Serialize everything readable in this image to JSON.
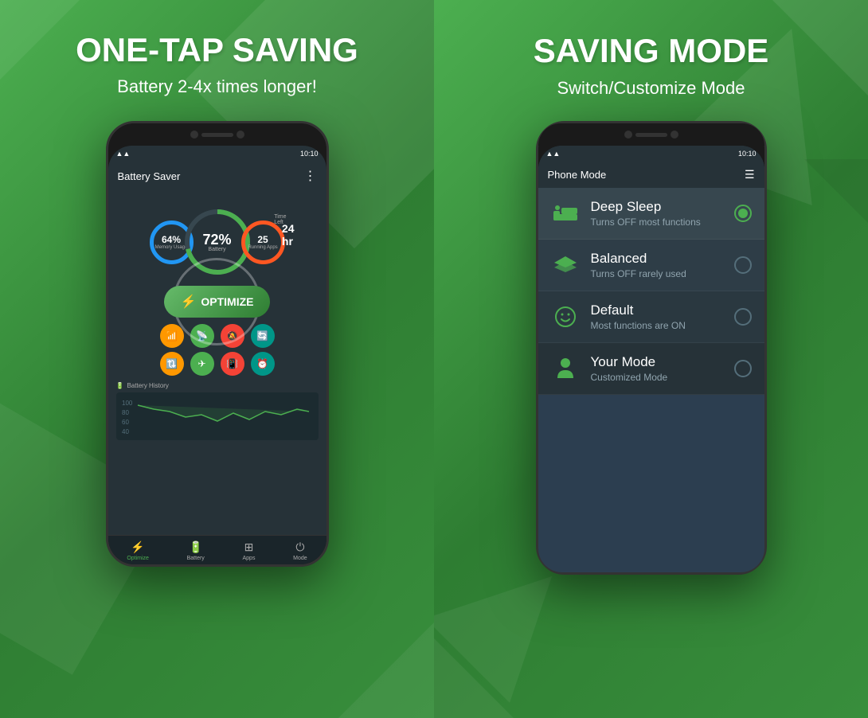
{
  "left": {
    "title": "ONE-TAP SAVING",
    "subtitle": "Battery 2-4x times longer!",
    "phone": {
      "status_time": "10:10",
      "app_title": "Battery",
      "app_title_suffix": " Saver",
      "battery_pct": "72%",
      "battery_label": "Battery",
      "memory_pct": "64%",
      "memory_label": "Memory Usage",
      "apps_count": "25",
      "apps_label": "Running Apps",
      "time_left_label": "Time Left",
      "time_left_value": "24 hr",
      "optimize_label": "OPTIMIZE",
      "history_label": "Battery History",
      "nav_items": [
        "Optimize",
        "Battery",
        "Apps",
        "Mode"
      ]
    }
  },
  "right": {
    "title": "SAVING MODE",
    "subtitle": "Switch/Customize Mode",
    "phone": {
      "status_time": "10:10",
      "app_title": "Phone",
      "app_title_suffix": " Mode",
      "modes": [
        {
          "name": "Deep Sleep",
          "desc": "Turns OFF most functions",
          "icon": "bed",
          "selected": true
        },
        {
          "name": "Balanced",
          "desc": "Turns OFF rarely used",
          "icon": "layers",
          "selected": false
        },
        {
          "name": "Default",
          "desc": "Most functions are ON",
          "icon": "smiley",
          "selected": false
        },
        {
          "name": "Your Mode",
          "desc": "Customized Mode",
          "icon": "person",
          "selected": false
        }
      ]
    }
  }
}
